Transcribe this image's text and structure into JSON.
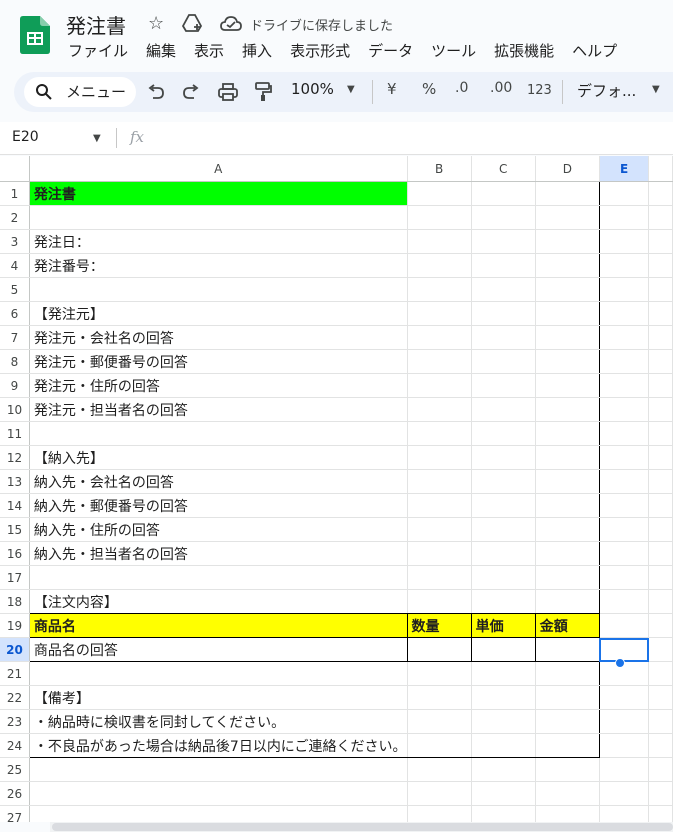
{
  "app": {
    "doc_title": "発注書",
    "save_status": "ドライブに保存しました",
    "brand_color": "#0f9d58"
  },
  "menu": [
    "ファイル",
    "編集",
    "表示",
    "挿入",
    "表示形式",
    "データ",
    "ツール",
    "拡張機能",
    "ヘルプ"
  ],
  "toolbar": {
    "menu_search": "メニュー",
    "zoom": "100%",
    "currency": "¥",
    "percent": "%",
    "dec_decrease": ".0",
    "dec_increase": ".00",
    "number_format": "123",
    "font": "デフォ..."
  },
  "formula_bar": {
    "name_box": "E20",
    "fx": "fx"
  },
  "sheet": {
    "columns": [
      "A",
      "B",
      "C",
      "D",
      "E"
    ],
    "selected_column": "E",
    "selected_row": 20,
    "rows": [
      {
        "n": "1",
        "a": "発注書"
      },
      {
        "n": "2",
        "a": ""
      },
      {
        "n": "3",
        "a": "発注日："
      },
      {
        "n": "4",
        "a": "発注番号："
      },
      {
        "n": "5",
        "a": ""
      },
      {
        "n": "6",
        "a": "【発注元】"
      },
      {
        "n": "7",
        "a": "発注元・会社名の回答"
      },
      {
        "n": "8",
        "a": "発注元・郵便番号の回答"
      },
      {
        "n": "9",
        "a": "発注元・住所の回答"
      },
      {
        "n": "10",
        "a": "発注元・担当者名の回答"
      },
      {
        "n": "11",
        "a": ""
      },
      {
        "n": "12",
        "a": "【納入先】"
      },
      {
        "n": "13",
        "a": "納入先・会社名の回答"
      },
      {
        "n": "14",
        "a": "納入先・郵便番号の回答"
      },
      {
        "n": "15",
        "a": "納入先・住所の回答"
      },
      {
        "n": "16",
        "a": "納入先・担当者名の回答"
      },
      {
        "n": "17",
        "a": ""
      },
      {
        "n": "18",
        "a": "【注文内容】"
      },
      {
        "n": "19",
        "a": "商品名",
        "b": "数量",
        "c": "単価",
        "d": "金額"
      },
      {
        "n": "20",
        "a": "商品名の回答"
      },
      {
        "n": "21",
        "a": ""
      },
      {
        "n": "22",
        "a": "【備考】"
      },
      {
        "n": "23",
        "a": "・納品時に検収書を同封してください。"
      },
      {
        "n": "24",
        "a": "・不良品があった場合は納品後7日以内にご連絡ください。"
      },
      {
        "n": "25",
        "a": ""
      },
      {
        "n": "26",
        "a": ""
      },
      {
        "n": "27",
        "a": ""
      }
    ]
  }
}
